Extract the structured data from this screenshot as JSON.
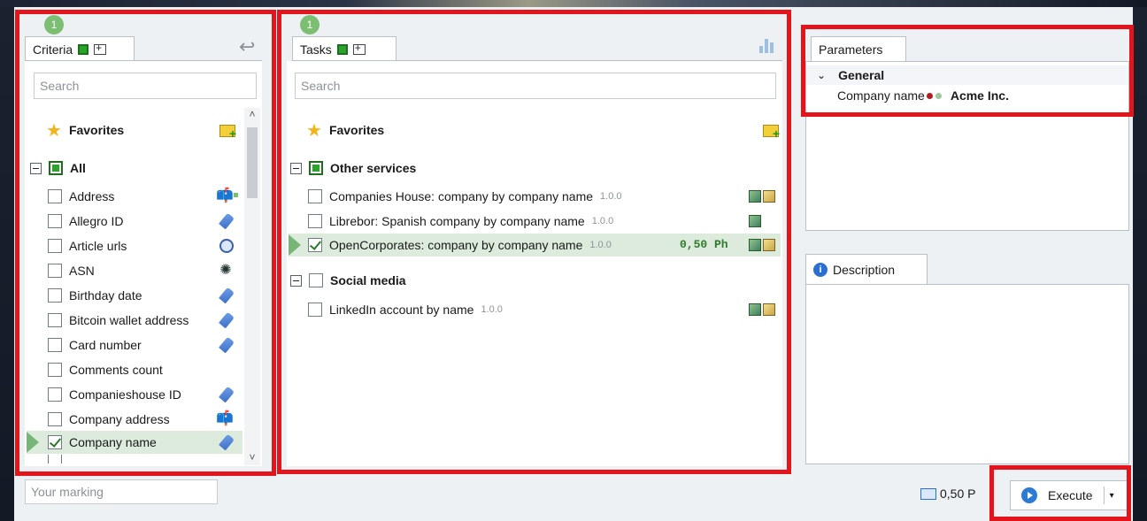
{
  "criteria": {
    "badge": "1",
    "tab_label": "Criteria",
    "search_placeholder": "Search",
    "favorites_label": "Favorites",
    "all_label": "All",
    "items": [
      {
        "label": "Address",
        "icon": "mailbox-icon",
        "checked": false
      },
      {
        "label": "Allegro ID",
        "icon": "tag-icon",
        "checked": false
      },
      {
        "label": "Article urls",
        "icon": "link-icon",
        "checked": false
      },
      {
        "label": "ASN",
        "icon": "network-icon",
        "checked": false
      },
      {
        "label": "Birthday date",
        "icon": "tag-icon",
        "checked": false
      },
      {
        "label": "Bitcoin wallet address",
        "icon": "tag-icon",
        "checked": false
      },
      {
        "label": "Card number",
        "icon": "tag-icon",
        "checked": false
      },
      {
        "label": "Comments count",
        "icon": "",
        "checked": false
      },
      {
        "label": "Companieshouse ID",
        "icon": "tag-icon",
        "checked": false
      },
      {
        "label": "Company address",
        "icon": "mailbox-icon",
        "checked": false
      },
      {
        "label": "Company name",
        "icon": "tag-icon",
        "checked": true
      }
    ]
  },
  "tasks": {
    "badge": "1",
    "tab_label": "Tasks",
    "search_placeholder": "Search",
    "favorites_label": "Favorites",
    "groups": [
      {
        "label": "Other services",
        "items": [
          {
            "label": "Companies House: company by company name",
            "version": "1.0.0",
            "price": "",
            "checked": false
          },
          {
            "label": "Librebor: Spanish company by company name",
            "version": "1.0.0",
            "price": "",
            "checked": false
          },
          {
            "label": "OpenCorporates: company by company name",
            "version": "1.0.0",
            "price": "0,50 Ph",
            "checked": true
          }
        ]
      },
      {
        "label": "Social media",
        "items": [
          {
            "label": "LinkedIn account by name",
            "version": "1.0.0",
            "price": "",
            "checked": false
          }
        ]
      }
    ]
  },
  "parameters": {
    "tab_label": "Parameters",
    "section": "General",
    "field_label": "Company name",
    "field_value": "Acme Inc."
  },
  "description": {
    "tab_label": "Description"
  },
  "footer": {
    "marking_placeholder": "Your marking",
    "cost": "0,50 P",
    "execute_label": "Execute"
  },
  "colors": {
    "highlight_red": "#e3141c",
    "badge_green": "#7cbf72",
    "selected_row": "#dcebdc"
  }
}
